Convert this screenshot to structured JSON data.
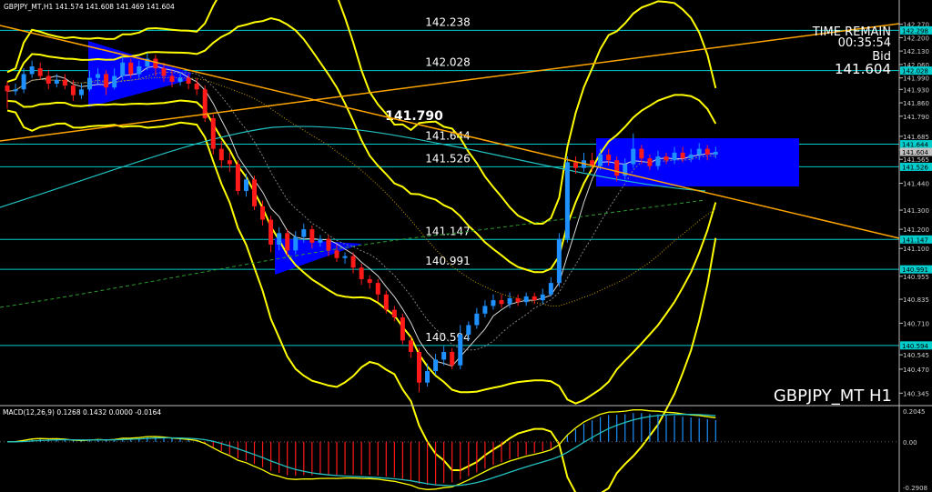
{
  "header": {
    "info": "GBPJPY_MT,H1  141.574 141.608 141.469 141.604",
    "symbol_label": "GBPJPY_MT H1"
  },
  "timer": {
    "label": "TIME REMAIN",
    "value": "00:35:54",
    "bid_label": "Bid",
    "bid_value": "141.604"
  },
  "colors": {
    "bg": "#000000",
    "bull": "#1e90ff",
    "bear": "#ff1a1a",
    "level": "#00cccc",
    "trend": "#ffa500",
    "band": "#ffff00",
    "ma": "#22c0c0",
    "zone": "#0000ff",
    "macd_line": "#ffff00",
    "signal_line": "#22c0c0"
  },
  "chart_data": {
    "type": "candlestick",
    "ylim": [
      140.28,
      142.33
    ],
    "y_ticks": [
      {
        "value": 142.27,
        "label": "142.270"
      },
      {
        "value": 142.2,
        "label": "142.200"
      },
      {
        "value": 142.13,
        "label": "142.130"
      },
      {
        "value": 142.06,
        "label": "142.060"
      },
      {
        "value": 141.99,
        "label": "141.990"
      },
      {
        "value": 141.93,
        "label": "141.930"
      },
      {
        "value": 141.86,
        "label": "141.860"
      },
      {
        "value": 141.79,
        "label": "141.790"
      },
      {
        "value": 141.685,
        "label": "141.685"
      },
      {
        "value": 141.615,
        "label": "141.615"
      },
      {
        "value": 141.565,
        "label": "141.565"
      },
      {
        "value": 141.44,
        "label": "141.440"
      },
      {
        "value": 141.3,
        "label": "141.300"
      },
      {
        "value": 141.2,
        "label": "141.200"
      },
      {
        "value": 141.1,
        "label": "141.100"
      },
      {
        "value": 140.955,
        "label": "140.955"
      },
      {
        "value": 140.835,
        "label": "140.835"
      },
      {
        "value": 140.71,
        "label": "140.710"
      },
      {
        "value": 140.545,
        "label": "140.545"
      },
      {
        "value": 140.47,
        "label": "140.470"
      },
      {
        "value": 140.345,
        "label": "140.345"
      }
    ],
    "levels": [
      {
        "value": 142.238,
        "label": "142.238",
        "tag": "142.298"
      },
      {
        "value": 142.028,
        "label": "142.028",
        "tag": "142.028"
      },
      {
        "value": 141.644,
        "label": "141.644",
        "tag": "141.644"
      },
      {
        "value": 141.526,
        "label": "141.526",
        "tag": "141.526"
      },
      {
        "value": 141.147,
        "label": "141.147",
        "tag": "141.147"
      },
      {
        "value": 140.991,
        "label": "140.991",
        "tag": "140.991"
      },
      {
        "value": 140.594,
        "label": "140.594",
        "tag": "140.594"
      }
    ],
    "key_level": {
      "value": 141.79,
      "label": "141.790"
    },
    "current_price": {
      "value": 141.604,
      "label": "141.604"
    },
    "candles": [
      [
        141.95,
        141.92,
        141.97,
        141.83
      ],
      [
        141.92,
        141.93,
        141.96,
        141.9
      ],
      [
        141.93,
        142.01,
        142.04,
        141.91
      ],
      [
        142.01,
        142.05,
        142.08,
        141.99
      ],
      [
        142.04,
        142.0,
        142.07,
        141.98
      ],
      [
        142.0,
        141.96,
        142.03,
        141.93
      ],
      [
        141.96,
        141.98,
        142.01,
        141.94
      ],
      [
        141.98,
        141.95,
        142.01,
        141.93
      ],
      [
        141.95,
        141.9,
        141.98,
        141.87
      ],
      [
        141.9,
        141.93,
        141.96,
        141.88
      ],
      [
        141.93,
        141.99,
        142.03,
        141.92
      ],
      [
        141.99,
        142.01,
        142.04,
        141.96
      ],
      [
        142.01,
        141.94,
        142.03,
        141.9
      ],
      [
        141.94,
        142.0,
        142.04,
        141.93
      ],
      [
        142.0,
        142.07,
        142.1,
        141.98
      ],
      [
        142.07,
        142.01,
        142.09,
        141.99
      ],
      [
        142.01,
        142.05,
        142.08,
        141.99
      ],
      [
        142.05,
        142.09,
        142.12,
        142.03
      ],
      [
        142.09,
        142.04,
        142.11,
        142.0
      ],
      [
        142.04,
        142.0,
        142.07,
        141.97
      ],
      [
        142.0,
        141.97,
        142.03,
        141.94
      ],
      [
        141.97,
        141.99,
        142.02,
        141.95
      ],
      [
        141.99,
        141.96,
        142.01,
        141.93
      ],
      [
        141.96,
        141.93,
        141.99,
        141.9
      ],
      [
        141.93,
        141.78,
        141.95,
        141.76
      ],
      [
        141.78,
        141.62,
        141.8,
        141.59
      ],
      [
        141.62,
        141.56,
        141.66,
        141.52
      ],
      [
        141.56,
        141.54,
        141.6,
        141.5
      ],
      [
        141.54,
        141.4,
        141.56,
        141.38
      ],
      [
        141.4,
        141.46,
        141.49,
        141.37
      ],
      [
        141.46,
        141.32,
        141.48,
        141.3
      ],
      [
        141.32,
        141.25,
        141.35,
        141.22
      ],
      [
        141.25,
        141.12,
        141.27,
        141.08
      ],
      [
        141.12,
        141.18,
        141.21,
        141.09
      ],
      [
        141.18,
        141.09,
        141.2,
        141.06
      ],
      [
        141.09,
        141.16,
        141.19,
        141.07
      ],
      [
        141.16,
        141.2,
        141.23,
        141.13
      ],
      [
        141.2,
        141.13,
        141.22,
        141.1
      ],
      [
        141.13,
        141.15,
        141.17,
        141.11
      ],
      [
        141.15,
        141.09,
        141.17,
        141.06
      ],
      [
        141.09,
        141.05,
        141.12,
        141.03
      ],
      [
        141.05,
        141.06,
        141.08,
        141.02
      ],
      [
        141.06,
        141.0,
        141.08,
        140.97
      ],
      [
        141.0,
        140.94,
        141.02,
        140.91
      ],
      [
        140.94,
        140.92,
        140.96,
        140.89
      ],
      [
        140.92,
        140.86,
        140.94,
        140.82
      ],
      [
        140.86,
        140.78,
        140.88,
        140.76
      ],
      [
        140.78,
        140.74,
        140.8,
        140.72
      ],
      [
        140.74,
        140.62,
        140.76,
        140.6
      ],
      [
        140.62,
        140.56,
        140.64,
        140.53
      ],
      [
        140.56,
        140.4,
        140.58,
        140.35
      ],
      [
        140.4,
        140.46,
        140.5,
        140.38
      ],
      [
        140.46,
        140.52,
        140.55,
        140.44
      ],
      [
        140.52,
        140.56,
        140.59,
        140.49
      ],
      [
        140.56,
        140.49,
        140.58,
        140.47
      ],
      [
        140.49,
        140.65,
        140.7,
        140.47
      ],
      [
        140.65,
        140.7,
        140.72,
        140.62
      ],
      [
        140.7,
        140.76,
        140.79,
        140.68
      ],
      [
        140.76,
        140.8,
        140.83,
        140.74
      ],
      [
        140.8,
        140.83,
        140.86,
        140.78
      ],
      [
        140.83,
        140.81,
        140.86,
        140.79
      ],
      [
        140.81,
        140.84,
        140.87,
        140.79
      ],
      [
        140.84,
        140.82,
        140.86,
        140.8
      ],
      [
        140.82,
        140.85,
        140.87,
        140.8
      ],
      [
        140.85,
        140.83,
        140.87,
        140.81
      ],
      [
        140.83,
        140.86,
        140.89,
        140.81
      ],
      [
        140.86,
        140.92,
        140.95,
        140.85
      ],
      [
        140.92,
        141.15,
        141.18,
        140.9
      ],
      [
        141.15,
        141.55,
        141.58,
        141.13
      ],
      [
        141.55,
        141.52,
        141.58,
        141.49
      ],
      [
        141.52,
        141.56,
        141.6,
        141.5
      ],
      [
        141.56,
        141.53,
        141.6,
        141.5
      ],
      [
        141.53,
        141.59,
        141.62,
        141.51
      ],
      [
        141.59,
        141.56,
        141.62,
        141.53
      ],
      [
        141.56,
        141.48,
        141.58,
        141.45
      ],
      [
        141.48,
        141.54,
        141.57,
        141.46
      ],
      [
        141.54,
        141.62,
        141.7,
        141.52
      ],
      [
        141.62,
        141.57,
        141.64,
        141.54
      ],
      [
        141.57,
        141.53,
        141.59,
        141.51
      ],
      [
        141.53,
        141.58,
        141.61,
        141.51
      ],
      [
        141.58,
        141.56,
        141.6,
        141.54
      ],
      [
        141.56,
        141.6,
        141.63,
        141.54
      ],
      [
        141.6,
        141.57,
        141.63,
        141.55
      ],
      [
        141.57,
        141.59,
        141.62,
        141.55
      ],
      [
        141.59,
        141.62,
        141.65,
        141.56
      ],
      [
        141.62,
        141.59,
        141.64,
        141.56
      ],
      [
        141.59,
        141.604,
        141.63,
        141.57
      ]
    ],
    "macd": {
      "label": "MACD(12,26,9) 0.1268 0.1432 0.0000 -0.0164",
      "ylim": [
        -0.2908,
        0.2045
      ],
      "ticks": [
        {
          "value": 0.2045,
          "label": "0.2045"
        },
        {
          "value": 0.0,
          "label": "0.00"
        },
        {
          "value": -0.2908,
          "label": "-0.2908"
        }
      ]
    }
  }
}
